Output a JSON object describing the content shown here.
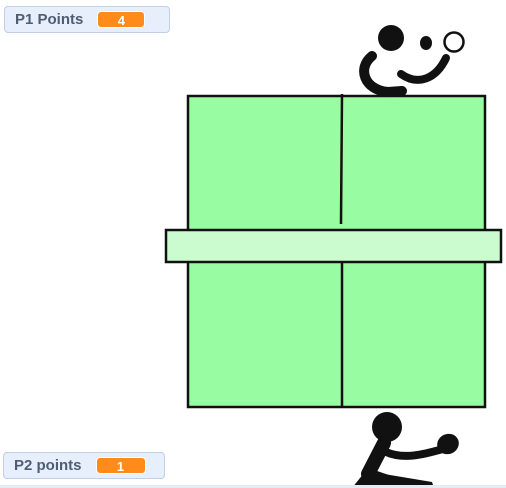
{
  "monitors": {
    "p1": {
      "label": "P1 Points",
      "value": "4"
    },
    "p2": {
      "label": "P2 points",
      "value": "1"
    }
  },
  "colors": {
    "table": "#98fca2",
    "net": "#cbfccf",
    "outline": "#111111",
    "monitor_value": "#ff8c1a",
    "monitor_bg": "#e6effb",
    "ball": "#ffffff"
  },
  "sprites": {
    "player1": "ping-pong-player-icon",
    "player2": "ping-pong-player-icon",
    "ball": "ping-pong-ball-icon",
    "table": "ping-pong-table",
    "net": "ping-pong-net"
  }
}
